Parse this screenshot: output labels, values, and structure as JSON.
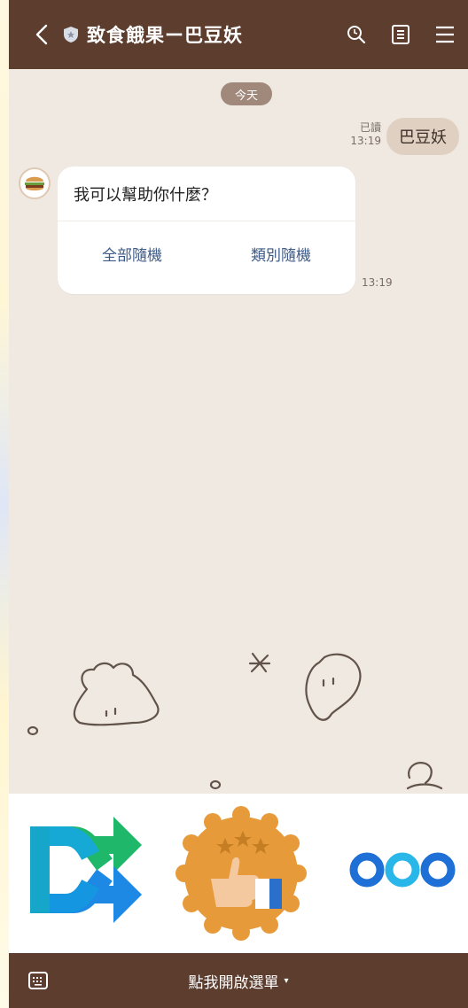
{
  "header": {
    "title": "致食餓果ー巴豆妖",
    "back_icon": "chevron-left-icon",
    "shield_icon": "shield-icon",
    "search_icon": "search-icon",
    "notes_icon": "notes-icon",
    "menu_icon": "hamburger-menu-icon",
    "bg_color": "#5c3d2e"
  },
  "chat": {
    "date_label": "今天",
    "outgoing": {
      "text": "巴豆妖",
      "read_label": "已讀",
      "time": "13:19"
    },
    "incoming": {
      "avatar": "burger-avatar-icon",
      "question": "我可以幫助你什麼？",
      "buttons": [
        "全部隨機",
        "類別隨機"
      ],
      "time": "13:19"
    },
    "bg_color": "#efe9e2"
  },
  "rich_menu": {
    "items": [
      {
        "name": "shuffle-icon"
      },
      {
        "name": "thumbs-up-badge-icon"
      },
      {
        "name": "more-dots-icon"
      }
    ]
  },
  "bottom_bar": {
    "keyboard_icon": "keyboard-icon",
    "menu_label": "點我開啟選單",
    "caret": "▾"
  }
}
